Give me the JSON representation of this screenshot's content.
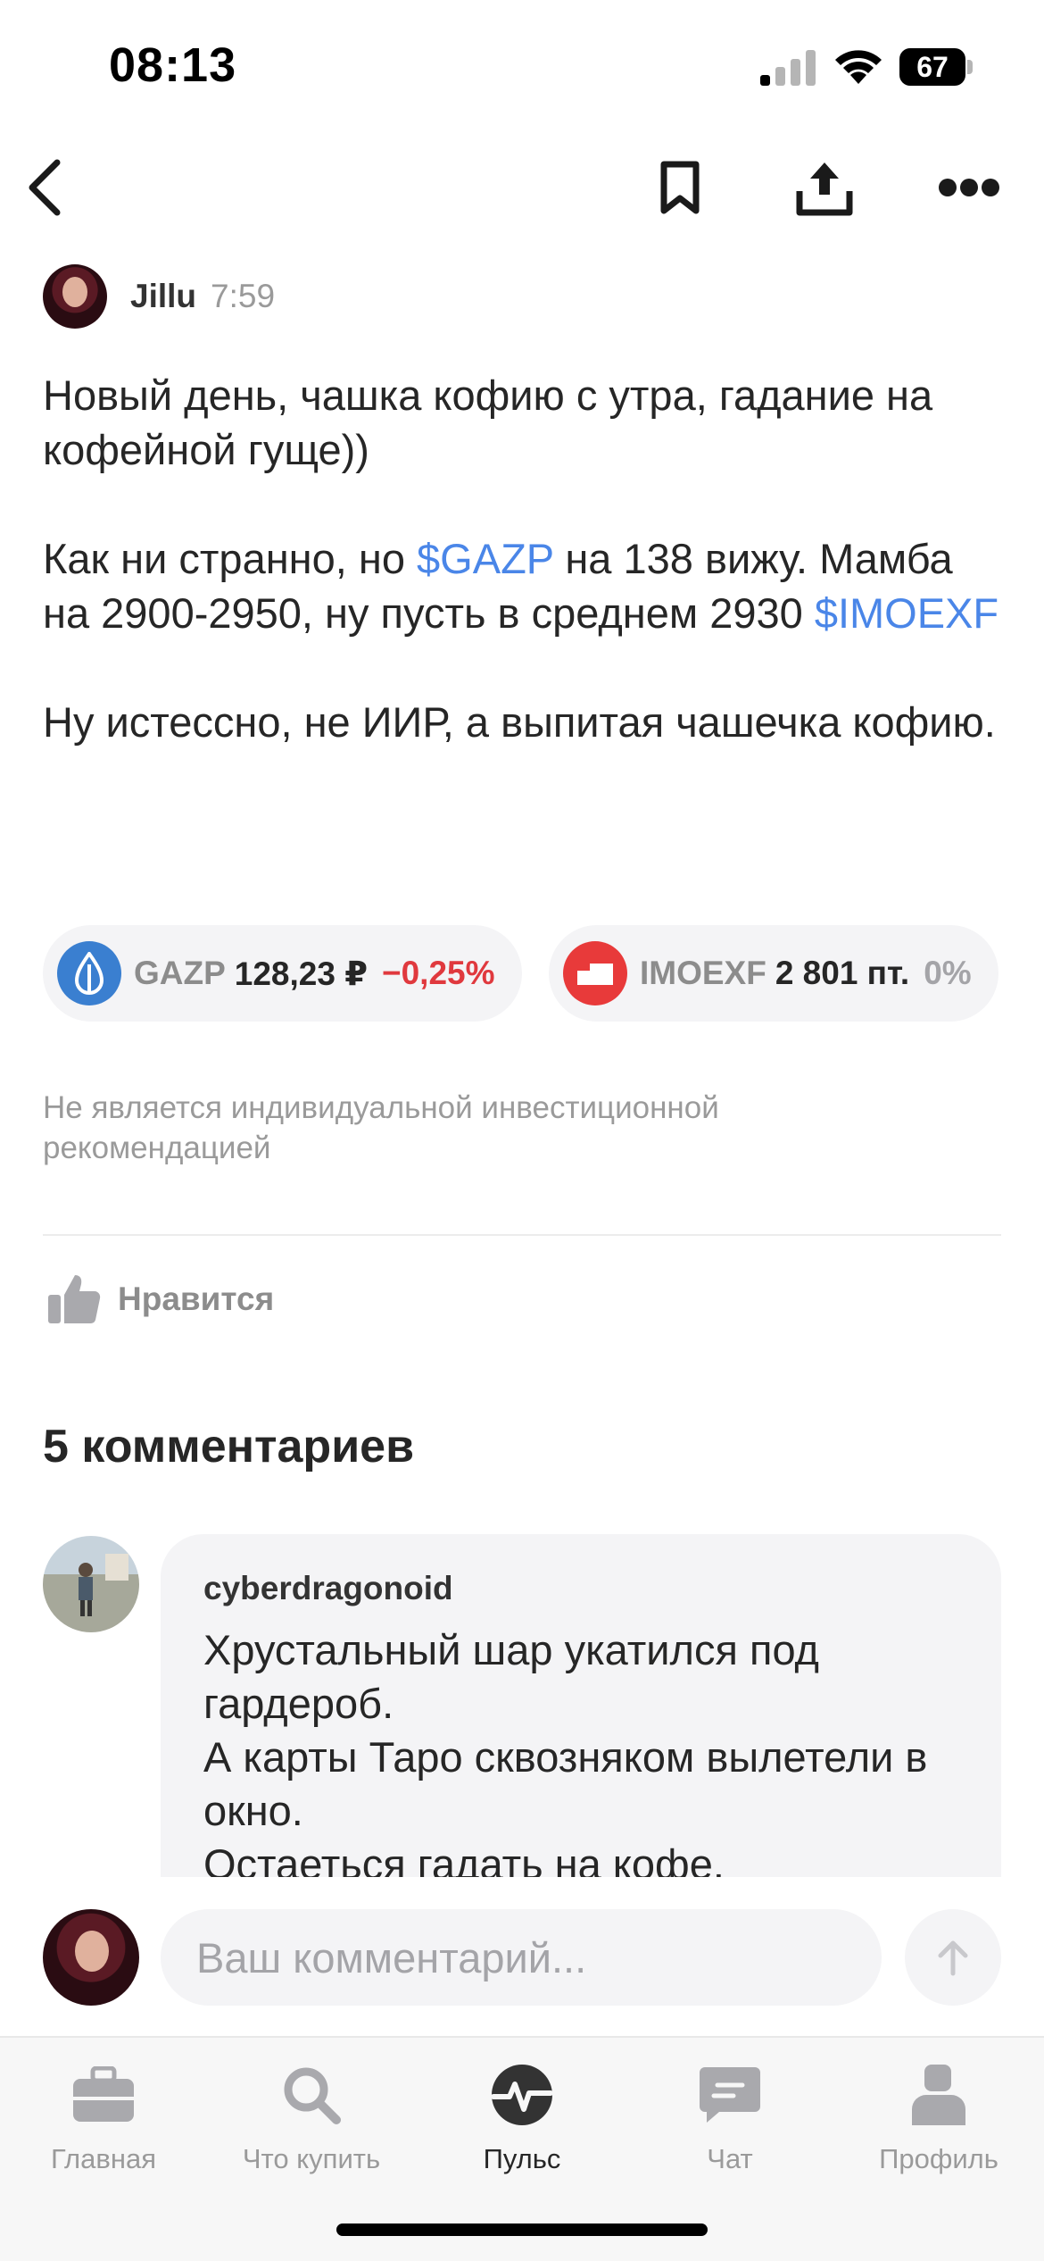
{
  "status_bar": {
    "time": "08:13",
    "battery": "67"
  },
  "header": {
    "back_icon": "chevron-left-icon",
    "bookmark_icon": "bookmark-icon",
    "share_icon": "share-icon",
    "more_icon": "more-icon"
  },
  "post": {
    "author": "Jillu",
    "time": "7:59",
    "paragraphs": {
      "p1": "Новый день, чашка кофию с утра, гадание на кофейной гуще))",
      "p2_before": "Как ни странно, но ",
      "p2_link": "$GAZP",
      "p2_after": " на 138 вижу. Мамба на 2900-2950, ну пусть в среднем 2930 ",
      "p2_link2": "$IMOEXF",
      "p3": "Ну истессно, не ИИР, а выпитая чашечка кофию."
    },
    "chips": [
      {
        "ticker": "GAZP",
        "price": "128,23 ₽",
        "change": "−0,25%",
        "change_color": "#e0393e",
        "logo_color": "#3a7fd0"
      },
      {
        "ticker": "IMOEXF",
        "price": "2 801 пт.",
        "change": "0%",
        "change_color": "#a4a4a8",
        "logo_color": "#e83a3a"
      }
    ],
    "disclaimer": "Не является индивидуальной инвестиционной рекомендацией",
    "like_label": "Нравится"
  },
  "comments": {
    "title": "5 комментариев",
    "items": [
      {
        "author": "cyberdragonoid",
        "text": "Хрустальный шар укатился под гардероб.\nА карты Таро сквозняком вылетели в окно.\nОстаеться гадать на кофе."
      }
    ]
  },
  "composer": {
    "placeholder": "Ваш комментарий..."
  },
  "tabbar": {
    "tabs": [
      {
        "label": "Главная",
        "icon": "briefcase-icon"
      },
      {
        "label": "Что купить",
        "icon": "search-icon"
      },
      {
        "label": "Пульс",
        "icon": "pulse-icon",
        "active": true
      },
      {
        "label": "Чат",
        "icon": "chat-icon"
      },
      {
        "label": "Профиль",
        "icon": "profile-icon"
      }
    ]
  }
}
